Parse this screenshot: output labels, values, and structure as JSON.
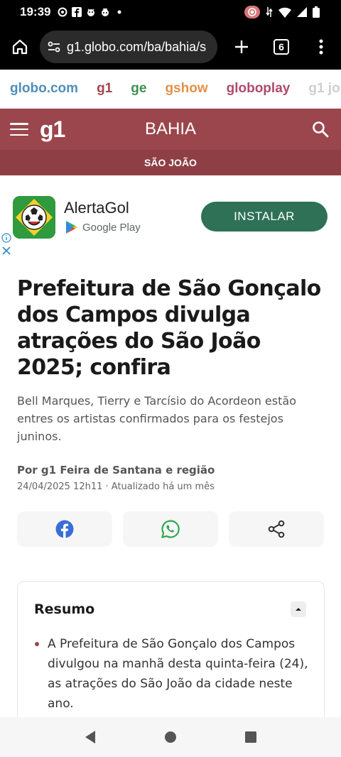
{
  "status_bar": {
    "time": "19:39",
    "icons_left": [
      "gear-icon",
      "facebook-icon",
      "app-icon",
      "app-icon",
      "dot-icon"
    ],
    "icons_right": [
      "record-icon",
      "data-icon",
      "wifi-icon",
      "signal-icon",
      "battery-icon"
    ]
  },
  "browser": {
    "url": "g1.globo.com/ba/bahia/s",
    "tab_count": "6"
  },
  "globo_nav": {
    "items": [
      {
        "label": "globo.com",
        "color": "#4d8fb8"
      },
      {
        "label": "g1",
        "color": "#a1464d"
      },
      {
        "label": "ge",
        "color": "#3f8f4f"
      },
      {
        "label": "gshow",
        "color": "#e3914a"
      },
      {
        "label": "globoplay",
        "color": "#b04a6b"
      },
      {
        "label": "g1 jo",
        "color": "#cfcfcf"
      }
    ]
  },
  "header": {
    "logo": "g1",
    "region": "BAHIA",
    "section": "SÃO JOÃO",
    "brand_color": "#9b464c"
  },
  "ad": {
    "app_name": "AlertaGol",
    "store": "Google Play",
    "install_label": "INSTALAR",
    "button_color": "#2e7156"
  },
  "article": {
    "headline": "Prefeitura de São Gonçalo dos Campos divulga atrações do São João 2025; confira",
    "subhead": "Bell Marques, Tierry e Tarcísio do Acordeon estão entres os artistas confirmados para os festejos juninos.",
    "byline": "Por g1 Feira de Santana e região",
    "date": "24/04/2025 12h11 · Atualizado há um mês"
  },
  "share": {
    "buttons": [
      "facebook-icon",
      "whatsapp-icon",
      "share-icon"
    ]
  },
  "summary": {
    "title": "Resumo",
    "items": [
      "A Prefeitura de São Gonçalo dos Campos divulgou na manhã desta quinta-feira (24), as atrações do São João da cidade neste ano."
    ]
  }
}
